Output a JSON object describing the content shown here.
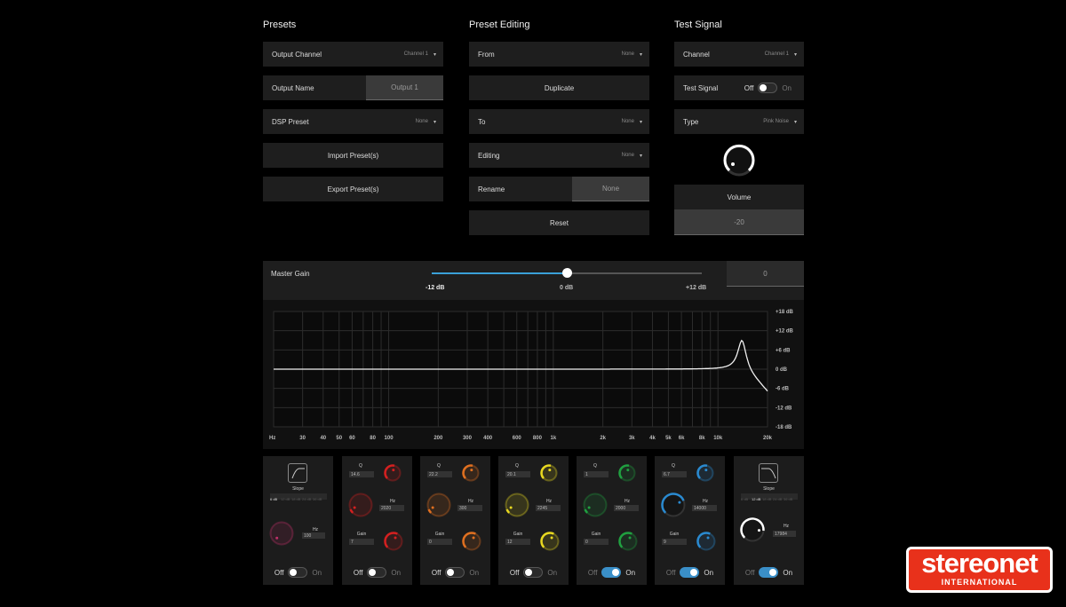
{
  "presets": {
    "title": "Presets",
    "output_channel": {
      "label": "Output Channel",
      "value": "Channel 1"
    },
    "output_name": {
      "label": "Output Name",
      "value": "Output 1"
    },
    "dsp_preset": {
      "label": "DSP Preset",
      "value": "None"
    },
    "import_label": "Import Preset(s)",
    "export_label": "Export Preset(s)"
  },
  "preset_editing": {
    "title": "Preset Editing",
    "from": {
      "label": "From",
      "value": "None"
    },
    "duplicate_label": "Duplicate",
    "to": {
      "label": "To",
      "value": "None"
    },
    "editing": {
      "label": "Editing",
      "value": "None"
    },
    "rename": {
      "label": "Rename",
      "value": "None"
    },
    "reset_label": "Reset"
  },
  "test_signal": {
    "title": "Test Signal",
    "channel": {
      "label": "Channel",
      "value": "Channel 1"
    },
    "toggle": {
      "label": "Test Signal",
      "off": "Off",
      "on": "On",
      "state": false
    },
    "type": {
      "label": "Type",
      "value": "Pink Noise"
    },
    "volume_label": "Volume",
    "volume_value": "-20"
  },
  "master_gain": {
    "label": "Master Gain",
    "value": "0",
    "min_label": "-12 dB",
    "mid_label": "0 dB",
    "max_label": "+12 dB",
    "level_fraction": 0.5
  },
  "graph": {
    "y_labels": [
      "+18 dB",
      "+12 dB",
      "+6 dB",
      "0 dB",
      "-6 dB",
      "-12 dB",
      "-18 dB"
    ],
    "x_labels": [
      {
        "text": "Hz",
        "f": 0
      },
      {
        "text": "30",
        "f": 30
      },
      {
        "text": "40",
        "f": 40
      },
      {
        "text": "50",
        "f": 50
      },
      {
        "text": "60",
        "f": 60
      },
      {
        "text": "80",
        "f": 80
      },
      {
        "text": "100",
        "f": 100
      },
      {
        "text": "200",
        "f": 200
      },
      {
        "text": "300",
        "f": 300
      },
      {
        "text": "400",
        "f": 400
      },
      {
        "text": "600",
        "f": 600
      },
      {
        "text": "800",
        "f": 800
      },
      {
        "text": "1k",
        "f": 1000
      },
      {
        "text": "2k",
        "f": 2000
      },
      {
        "text": "3k",
        "f": 3000
      },
      {
        "text": "4k",
        "f": 4000
      },
      {
        "text": "5k",
        "f": 5000
      },
      {
        "text": "6k",
        "f": 6000
      },
      {
        "text": "8k",
        "f": 8000
      },
      {
        "text": "10k",
        "f": 10000
      },
      {
        "text": "20k",
        "f": 20000
      }
    ],
    "peak": {
      "hz": 14000,
      "gain_db": 9,
      "q": 6.7
    }
  },
  "eq_modules": [
    {
      "kind": "highpass",
      "icon": "highpass-icon",
      "slope_label": "Slope",
      "slopes": [
        "6 dB",
        "12 dB",
        "18 dB",
        "24 dB",
        "36 dB"
      ],
      "hz_label": "Hz",
      "hz": "100",
      "toggle": {
        "off": "Off",
        "on": "On",
        "state": false
      },
      "color": "#c0306a"
    },
    {
      "kind": "peak",
      "q_label": "Q",
      "q": "14.6",
      "hz_label": "Hz",
      "hz": "2020",
      "gain_label": "Gain",
      "gain": "7",
      "color": "#d42020",
      "toggle": {
        "off": "Off",
        "on": "On",
        "state": false
      }
    },
    {
      "kind": "peak",
      "q_label": "Q",
      "q": "22.2",
      "hz_label": "Hz",
      "hz": "300",
      "gain_label": "Gain",
      "gain": "0",
      "color": "#e07020",
      "toggle": {
        "off": "Off",
        "on": "On",
        "state": false
      }
    },
    {
      "kind": "peak",
      "q_label": "Q",
      "q": "20.1",
      "hz_label": "Hz",
      "hz": "2245",
      "gain_label": "Gain",
      "gain": "12",
      "color": "#e8d820",
      "toggle": {
        "off": "Off",
        "on": "On",
        "state": false
      }
    },
    {
      "kind": "peak",
      "q_label": "Q",
      "q": "1",
      "hz_label": "Hz",
      "hz": "2000",
      "gain_label": "Gain",
      "gain": "0",
      "color": "#20a040",
      "toggle": {
        "off": "Off",
        "on": "On",
        "state": true
      }
    },
    {
      "kind": "peak",
      "q_label": "Q",
      "q": "6.7",
      "hz_label": "Hz",
      "hz": "14000",
      "gain_label": "Gain",
      "gain": "9",
      "color": "#2a8ad0",
      "toggle": {
        "off": "Off",
        "on": "On",
        "state": true
      }
    },
    {
      "kind": "lowpass",
      "icon": "lowpass-icon",
      "slope_label": "Slope",
      "slopes": [
        "6 dB",
        "12 dB",
        "18 dB",
        "24 dB",
        "36 dB"
      ],
      "hz_label": "Hz",
      "hz": "17984",
      "toggle": {
        "off": "Off",
        "on": "On",
        "state": true
      },
      "color": "#ffffff"
    }
  ],
  "logo": {
    "main": "stereonet",
    "sub": "INTERNATIONAL"
  }
}
